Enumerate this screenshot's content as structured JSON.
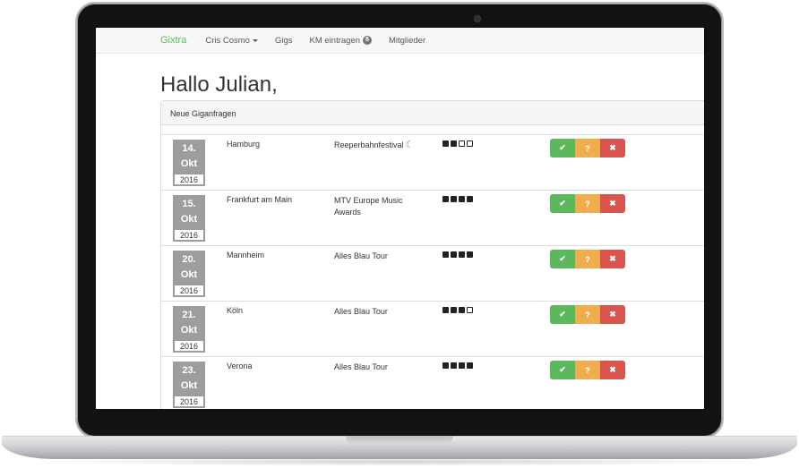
{
  "nav": {
    "brand": "Gixtra",
    "user": "Cris Cosmo",
    "gigs": "Gigs",
    "km": "KM eintragen",
    "km_badge": "8",
    "members": "Mitglieder"
  },
  "page": {
    "title": "Hallo Julian,",
    "panel_heading": "Neue Giganfragen"
  },
  "gigs": [
    {
      "day": "14.",
      "month": "Okt",
      "year": "2016",
      "city": "Hamburg",
      "event": "Reeperbahnfestival",
      "night": true,
      "rating": 2
    },
    {
      "day": "15.",
      "month": "Okt",
      "year": "2016",
      "city": "Frankfurt am Main",
      "event": "MTV Europe Music Awards",
      "night": false,
      "rating": 4
    },
    {
      "day": "20.",
      "month": "Okt",
      "year": "2016",
      "city": "Mannheim",
      "event": "Alles Blau Tour",
      "night": false,
      "rating": 4
    },
    {
      "day": "21.",
      "month": "Okt",
      "year": "2016",
      "city": "Köln",
      "event": "Alles Blau Tour",
      "night": false,
      "rating": 3
    },
    {
      "day": "23.",
      "month": "Okt",
      "year": "2016",
      "city": "Verona",
      "event": "Alles Blau Tour",
      "night": false,
      "rating": 4
    }
  ],
  "rating_max": 4,
  "actions": {
    "yes": "✔",
    "maybe": "?",
    "no": "✖"
  },
  "icons": {
    "night": "moon-icon"
  },
  "colors": {
    "brand": "#5cb85c",
    "yes": "#5cb85c",
    "maybe": "#f0ad4e",
    "no": "#d9534f",
    "date_bg": "#9d9d9d"
  }
}
